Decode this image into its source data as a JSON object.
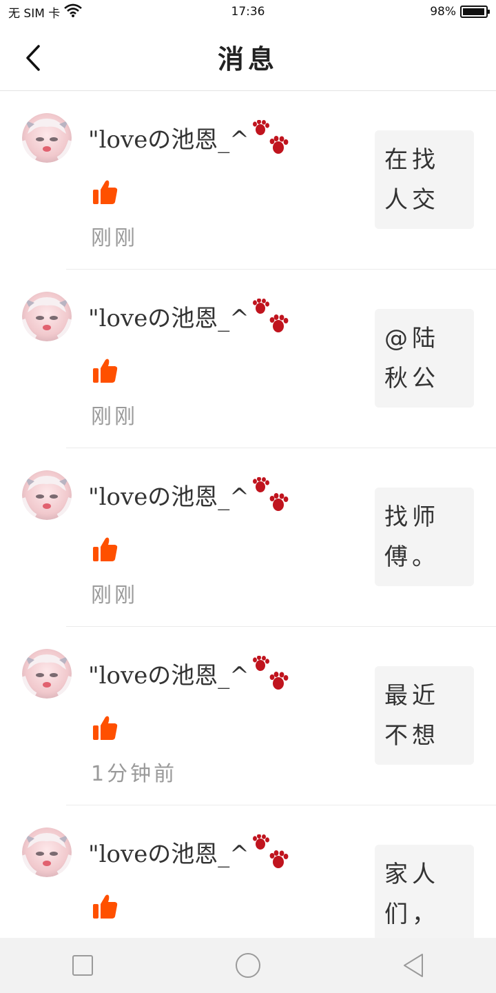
{
  "status_bar": {
    "carrier": "无 SIM 卡",
    "time": "17:36",
    "battery_percent": "98%",
    "battery_level": 0.98
  },
  "header": {
    "title": "消息"
  },
  "messages": [
    {
      "username": "\"loveの池恩_^",
      "time": "刚刚",
      "preview": "在找人交"
    },
    {
      "username": "\"loveの池恩_^",
      "time": "刚刚",
      "preview": "@陆秋公"
    },
    {
      "username": "\"loveの池恩_^",
      "time": "刚刚",
      "preview": "找师傅。"
    },
    {
      "username": "\"loveの池恩_^",
      "time": "1分钟前",
      "preview": "最近不想"
    },
    {
      "username": "\"loveの池恩_^",
      "time": "",
      "preview": "家人们，"
    }
  ],
  "icons": {
    "back": "chevron-left-icon",
    "like": "thumbs-up-icon",
    "paw": "paw-print-icon",
    "nav_recent": "square-icon",
    "nav_home": "circle-icon",
    "nav_back": "triangle-back-icon"
  },
  "colors": {
    "like": "#ff5000",
    "paw": "#c0141e",
    "preview_bg": "#f4f4f4",
    "time_text": "#9a9a9a"
  }
}
